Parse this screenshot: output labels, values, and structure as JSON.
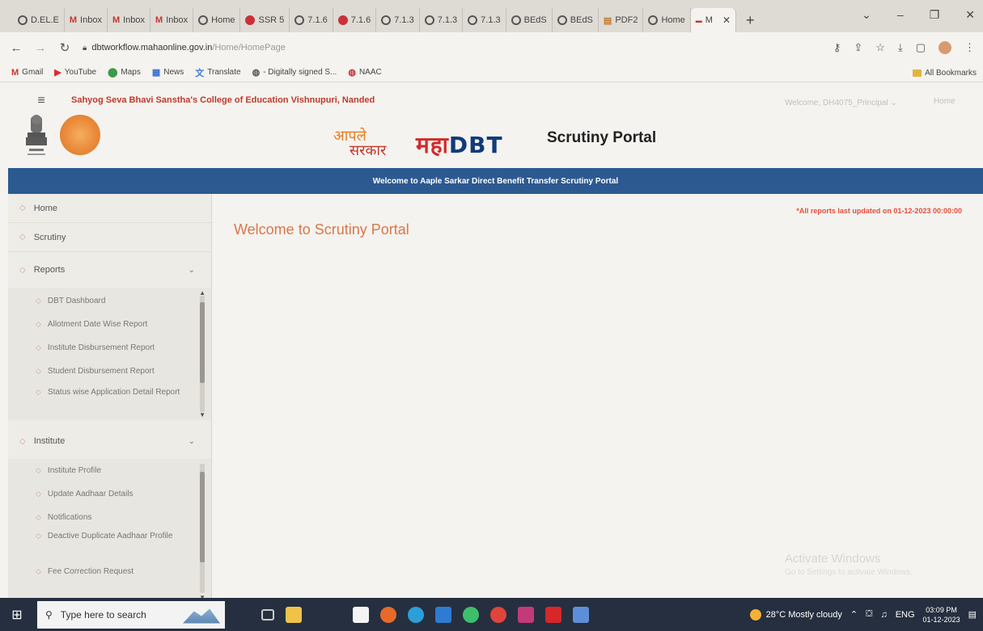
{
  "browser": {
    "tabs": [
      {
        "label": "D.EL.E",
        "icon": "globe-icon",
        "active": false
      },
      {
        "label": "Inbox",
        "icon": "gmail-icon",
        "active": false
      },
      {
        "label": "Inbox",
        "icon": "gmail-icon",
        "active": false
      },
      {
        "label": "Inbox",
        "icon": "gmail-icon",
        "active": false
      },
      {
        "label": "Home",
        "icon": "globe-icon",
        "active": false
      },
      {
        "label": "SSR 5",
        "icon": "red-globe-icon",
        "active": false
      },
      {
        "label": "7.1.6",
        "icon": "globe-icon",
        "active": false
      },
      {
        "label": "7.1.6",
        "icon": "red-globe-icon",
        "active": false
      },
      {
        "label": "7.1.3",
        "icon": "globe-icon",
        "active": false
      },
      {
        "label": "7.1.3",
        "icon": "globe-icon",
        "active": false
      },
      {
        "label": "7.1.3",
        "icon": "globe-icon",
        "active": false
      },
      {
        "label": "BEdS",
        "icon": "globe-icon",
        "active": false
      },
      {
        "label": "BEdS",
        "icon": "globe-icon",
        "active": false
      },
      {
        "label": "PDF2",
        "icon": "pdf-icon",
        "active": false
      },
      {
        "label": "Home",
        "icon": "globe-icon",
        "active": false
      },
      {
        "label": "M",
        "icon": "dbt-icon",
        "active": true
      }
    ],
    "new_tab": "+",
    "url_domain": "dbtworkflow.mahaonline.gov.in",
    "url_path": "/Home/HomePage",
    "bookmarks": [
      {
        "label": "Gmail",
        "icon": "gmail-icon"
      },
      {
        "label": "YouTube",
        "icon": "youtube-icon"
      },
      {
        "label": "Maps",
        "icon": "maps-icon"
      },
      {
        "label": "News",
        "icon": "news-icon"
      },
      {
        "label": "Translate",
        "icon": "translate-icon"
      },
      {
        "label": "- Digitally signed S...",
        "icon": "globe-icon"
      },
      {
        "label": "NAAC",
        "icon": "red-globe-icon"
      }
    ],
    "all_bookmarks": "All Bookmarks"
  },
  "header": {
    "college_name": "Sahyog Seva Bhavi Sanstha's College of Education Vishnupuri, Nanded",
    "welcome_user": "Welcome, DH4075_Principal",
    "home_link": "Home",
    "aaple_line1": "आपले",
    "aaple_line2": "सरकार",
    "maha": "महा",
    "dbt": "DBT",
    "portal_title": "Scrutiny Portal",
    "banner": "Welcome to Aaple Sarkar Direct Benefit Transfer Scrutiny Portal"
  },
  "sidebar": {
    "home": "Home",
    "scrutiny": "Scrutiny",
    "reports": {
      "label": "Reports",
      "items": [
        "DBT Dashboard",
        "Allotment Date Wise Report",
        "Institute Disbursement Report",
        "Student Disbursement Report",
        "Status wise Application Detail Report"
      ]
    },
    "institute": {
      "label": "Institute",
      "items": [
        "Institute Profile",
        "Update Aadhaar Details",
        "Notifications",
        "Deactive Duplicate Aadhaar Profile",
        "Fee Correction Request"
      ]
    }
  },
  "main": {
    "updated_note": "*All reports last updated on 01-12-2023 00:00:00",
    "title": "Welcome to Scrutiny Portal",
    "watermark_title": "Activate Windows",
    "watermark_sub": "Go to Settings to activate Windows."
  },
  "taskbar": {
    "search_placeholder": "Type here to search",
    "weather": "28°C  Mostly cloudy",
    "language": "ENG",
    "time": "03:09 PM",
    "date": "01-12-2023"
  }
}
